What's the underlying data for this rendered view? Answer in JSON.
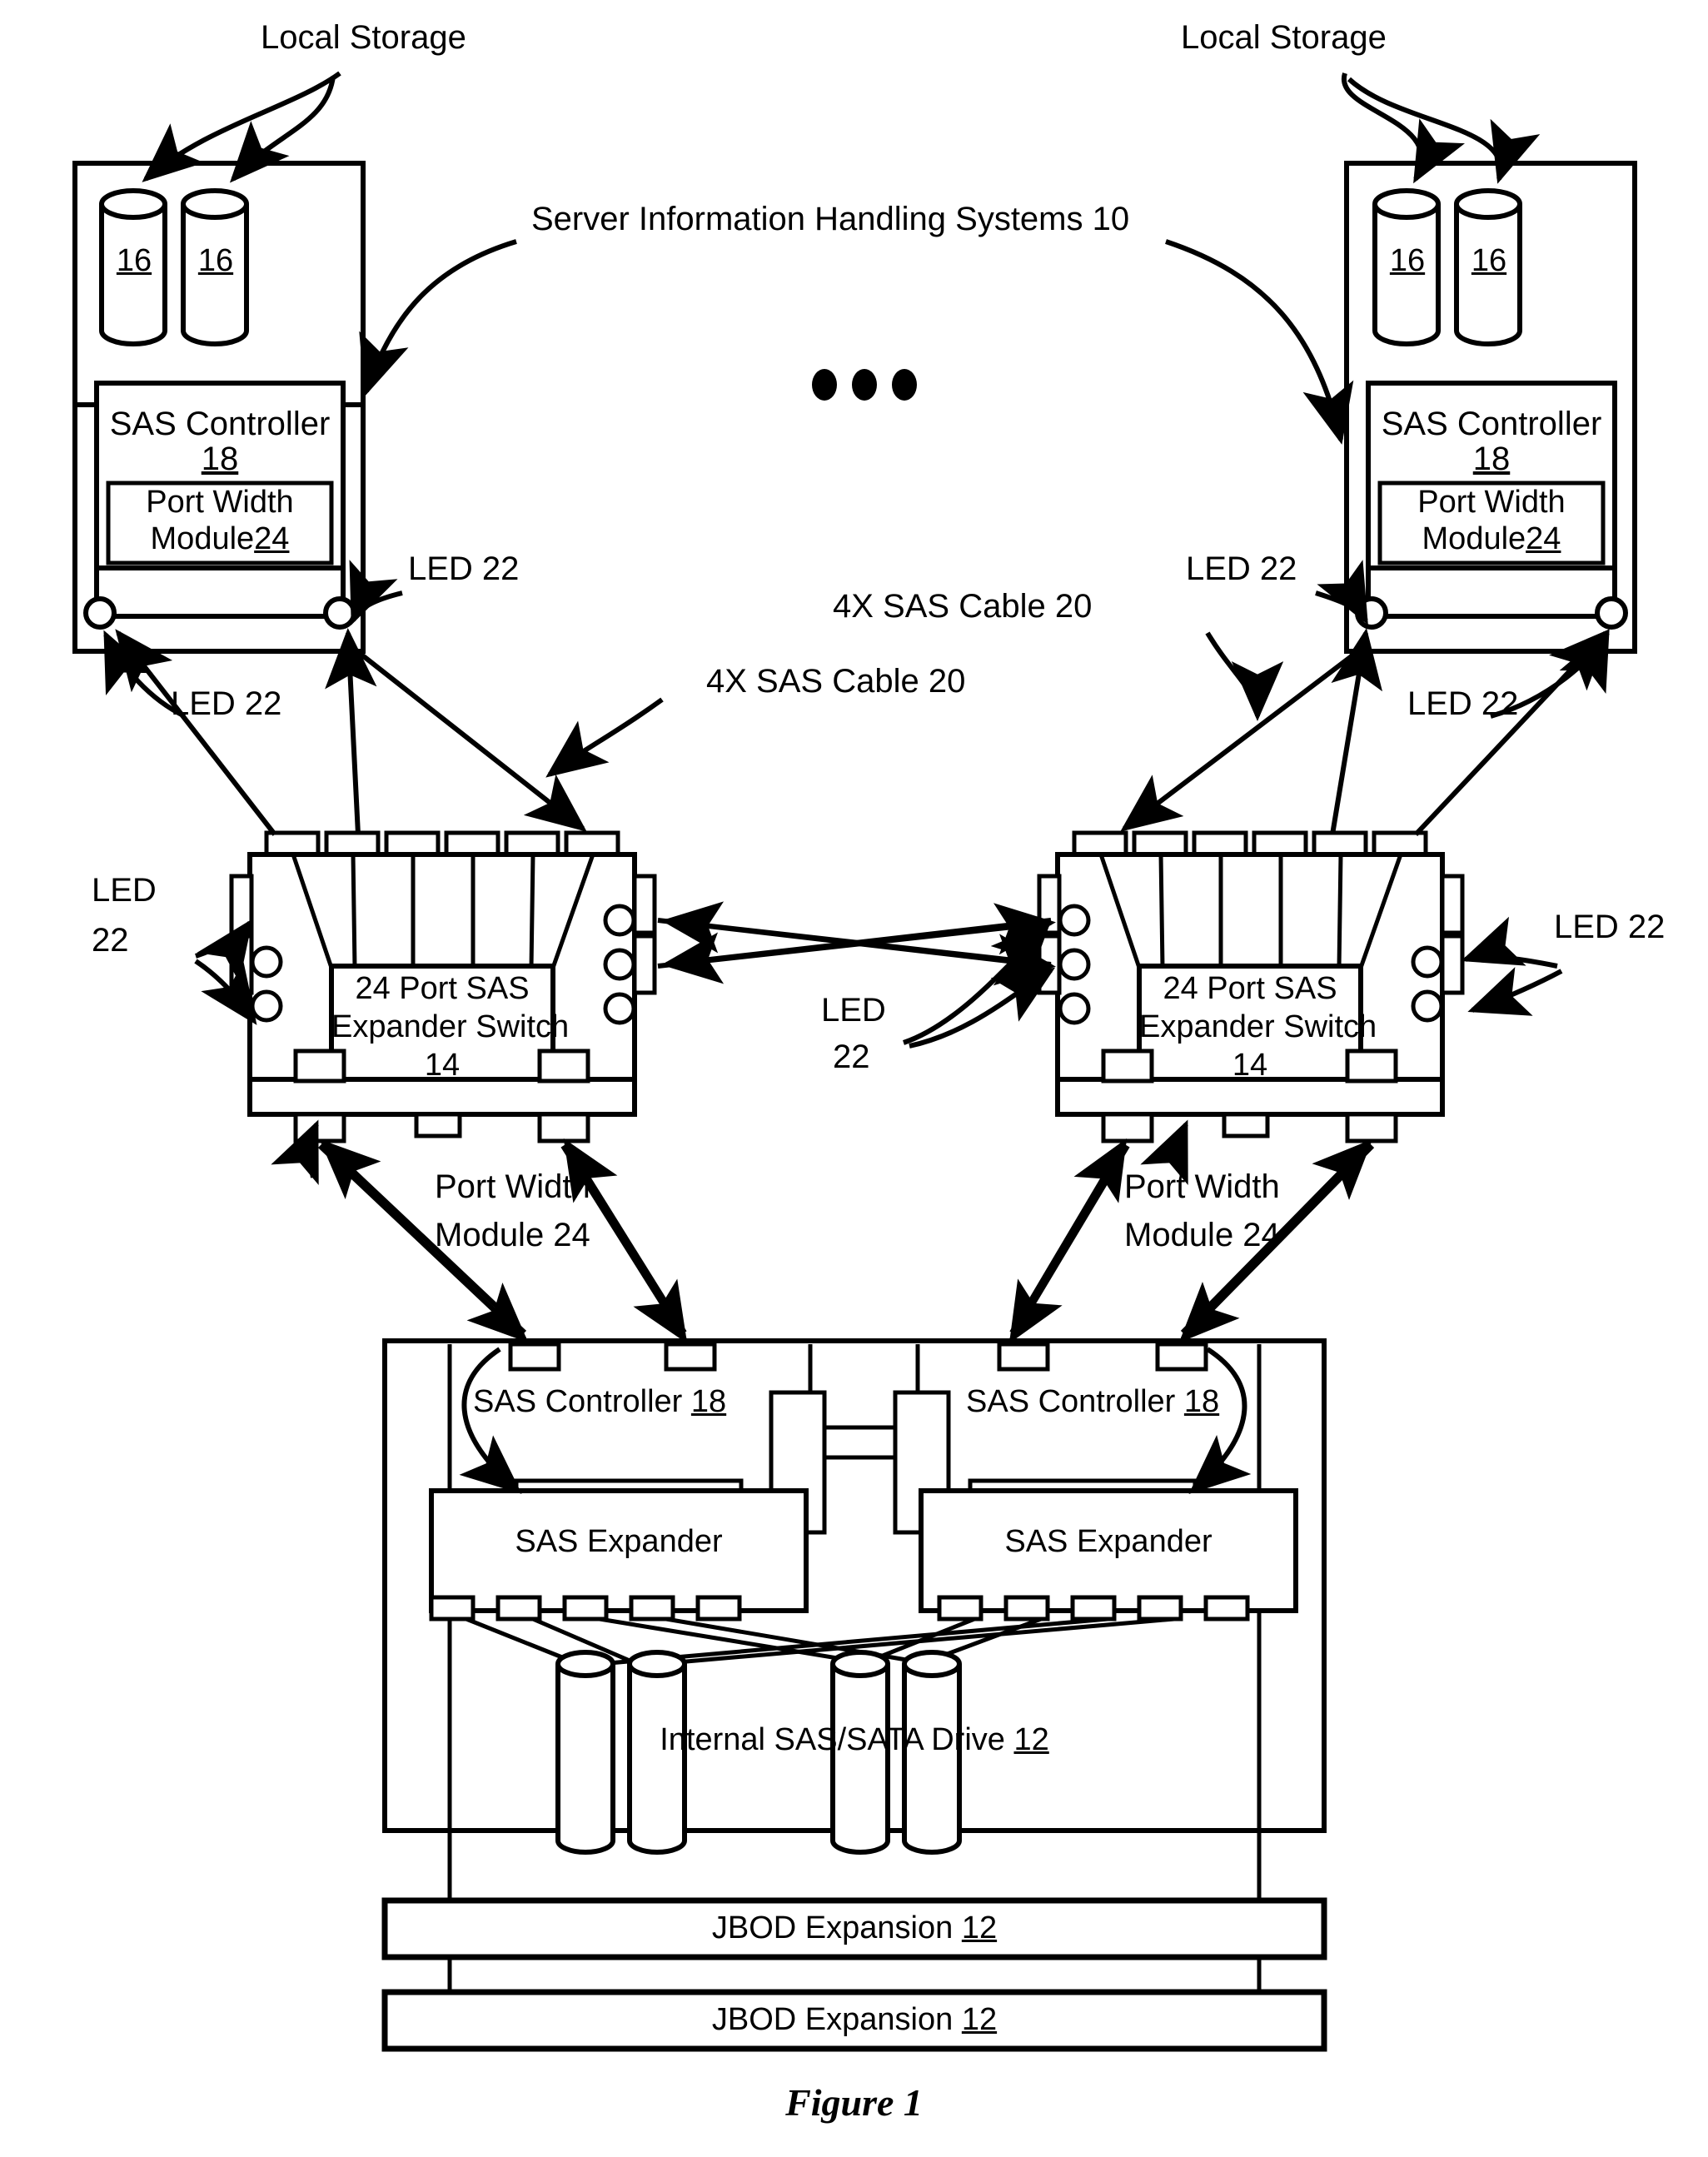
{
  "figure": {
    "caption": "Figure 1",
    "title_annotation": "Server Information Handling Systems 10",
    "ellipsis": "● ● ●"
  },
  "annotations": {
    "local_storage_left": "Local Storage",
    "local_storage_right": "Local Storage",
    "server_systems": "Server Information Handling Systems 10",
    "sas_cable_left": "4X SAS Cable 20",
    "sas_cable_right": "4X SAS Cable 20",
    "led_left_upper": "LED 22",
    "led_left_lower": "LED 22",
    "led_right_upper": "LED 22",
    "led_right_lower": "LED 22",
    "led_switch_left_line1": "LED",
    "led_switch_left_line2": "22",
    "led_switch_mid_line1": "LED",
    "led_switch_mid_line2": "22",
    "led_switch_right": "LED 22",
    "port_width_module_left_line1": "Port Width",
    "port_width_module_left_line2": "Module 24",
    "port_width_module_right_line1": "Port Width",
    "port_width_module_right_line2": "Module 24"
  },
  "server_left": {
    "drive_a": "16",
    "drive_b": "16",
    "controller_name": "SAS Controller",
    "controller_ref": "18",
    "module_line1": "Port Width",
    "module_line2_text": "Module",
    "module_line2_ref": "24"
  },
  "server_right": {
    "drive_a": "16",
    "drive_b": "16",
    "controller_name": "SAS Controller",
    "controller_ref": "18",
    "module_line1": "Port Width",
    "module_line2_text": "Module",
    "module_line2_ref": "24"
  },
  "switch_left": {
    "line1": "24 Port SAS",
    "line2": "Expander Switch",
    "ref": "14"
  },
  "switch_right": {
    "line1": "24 Port SAS",
    "line2": "Expander Switch",
    "ref": "14"
  },
  "enclosure": {
    "controller_left_text": "SAS Controller",
    "controller_left_ref": "18",
    "controller_right_text": "SAS Controller",
    "controller_right_ref": "18",
    "expander_left": "SAS Expander",
    "expander_right": "SAS Expander",
    "internal_drive_text": "Internal SAS/SATA Drive",
    "internal_drive_ref": "12"
  },
  "jbod": [
    {
      "text": "JBOD Expansion",
      "ref": "12"
    },
    {
      "text": "JBOD Expansion",
      "ref": "12"
    }
  ],
  "colors": {
    "line": "#000000",
    "fill": "#ffffff"
  }
}
